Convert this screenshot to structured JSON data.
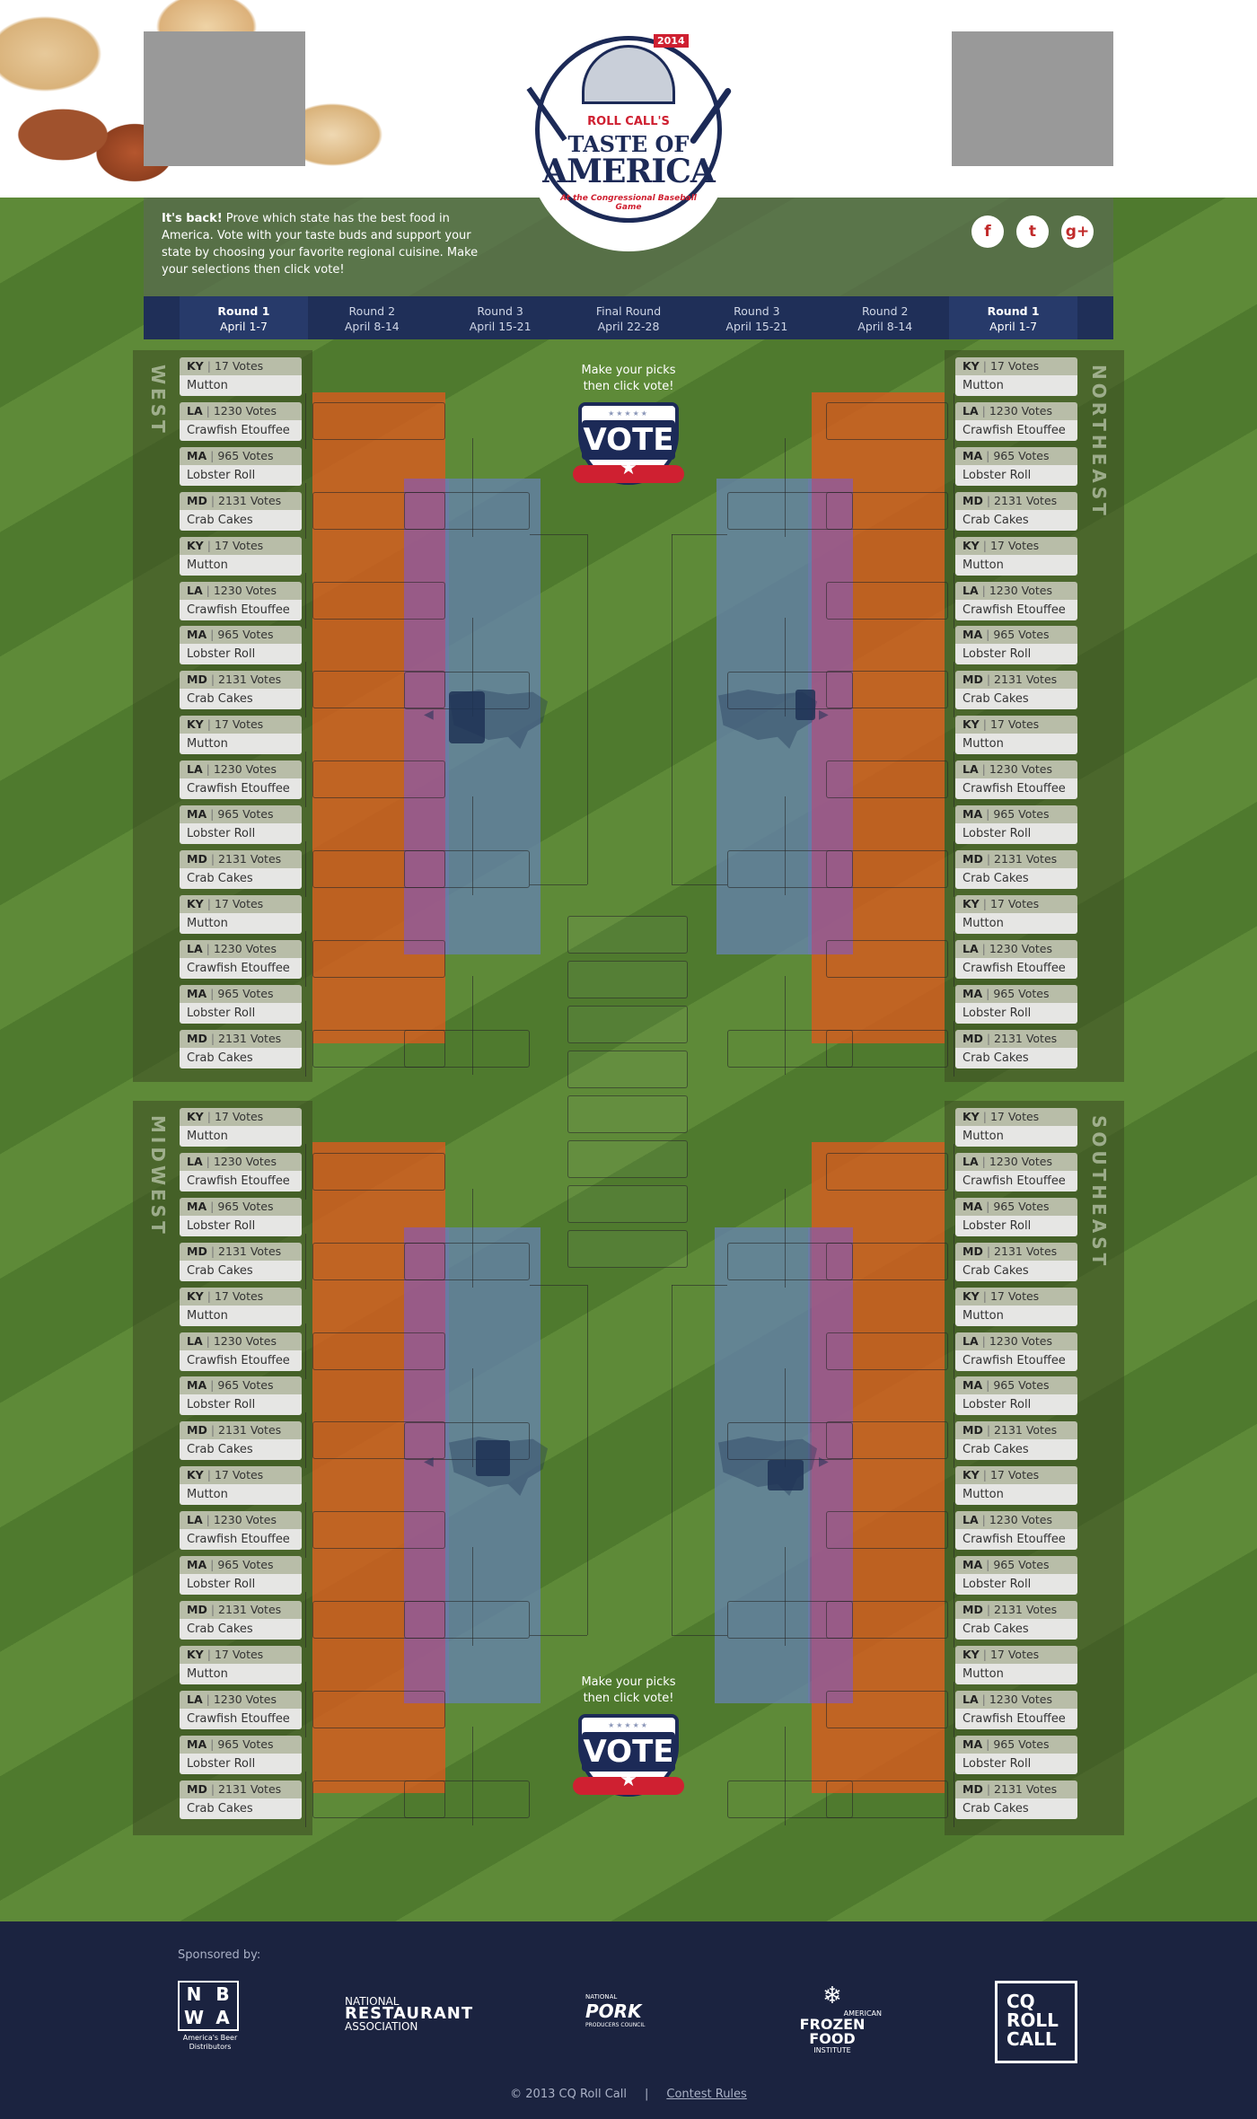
{
  "logo": {
    "year": "2014",
    "roll_call": "ROLL CALL'S",
    "taste_of": "TASTE OF",
    "america": "AMERICA",
    "subtitle": "At the Congressional Baseball Game"
  },
  "intro": {
    "lead": "It's back!",
    "text": " Prove which state has the best food in America. Vote with your taste buds and support your state by choosing your favorite regional cuisine. Make your selections then click vote!"
  },
  "social": {
    "facebook": "f",
    "twitter": "t",
    "googleplus": "g+",
    "facebook_icon": "facebook-icon",
    "twitter_icon": "twitter-icon",
    "googleplus_icon": "google-plus-icon"
  },
  "rounds": [
    {
      "name": "Round 1",
      "dates": "April 1-7"
    },
    {
      "name": "Round 2",
      "dates": "April 8-14"
    },
    {
      "name": "Round 3",
      "dates": "April 15-21"
    },
    {
      "name": "Final Round",
      "dates": "April 22-28"
    },
    {
      "name": "Round 3",
      "dates": "April 15-21"
    },
    {
      "name": "Round 2",
      "dates": "April 8-14"
    },
    {
      "name": "Round 1",
      "dates": "April 1-7"
    }
  ],
  "regions": {
    "west": "WEST",
    "northeast": "NORTHEAST",
    "midwest": "MIDWEST",
    "southeast": "SOUTHEAST"
  },
  "entry_template": [
    {
      "state": "KY",
      "votes": "17 Votes",
      "dish": "Mutton"
    },
    {
      "state": "LA",
      "votes": "1230 Votes",
      "dish": "Crawfish Etouffee"
    },
    {
      "state": "MA",
      "votes": "965 Votes",
      "dish": "Lobster Roll"
    },
    {
      "state": "MD",
      "votes": "2131 Votes",
      "dish": "Crab Cakes"
    }
  ],
  "vote": {
    "caption_line1": "Make your picks",
    "caption_line2": "then click vote!",
    "label": "VOTE",
    "stars": "★★★★★"
  },
  "footer": {
    "sponsored_by": "Sponsored by:",
    "nbwa_letters": [
      "N",
      "B",
      "W",
      "A"
    ],
    "nbwa_caption": "America's Beer Distributors",
    "nra_line1": "NATIONAL",
    "nra_line2": "RESTAURANT",
    "nra_line3": "ASSOCIATION",
    "pork_line1": "NATIONAL",
    "pork_line2": "PORK",
    "pork_line3": "PRODUCERS COUNCIL",
    "affi_line1": "AMERICAN",
    "affi_line2": "FROZEN FOOD",
    "affi_line3": "INSTITUTE",
    "cq_line1": "CQ",
    "cq_line2": "ROLL",
    "cq_line3": "CALL",
    "copyright": "© 2013 CQ Roll Call",
    "separator": "|",
    "contest_rules": "Contest Rules"
  }
}
